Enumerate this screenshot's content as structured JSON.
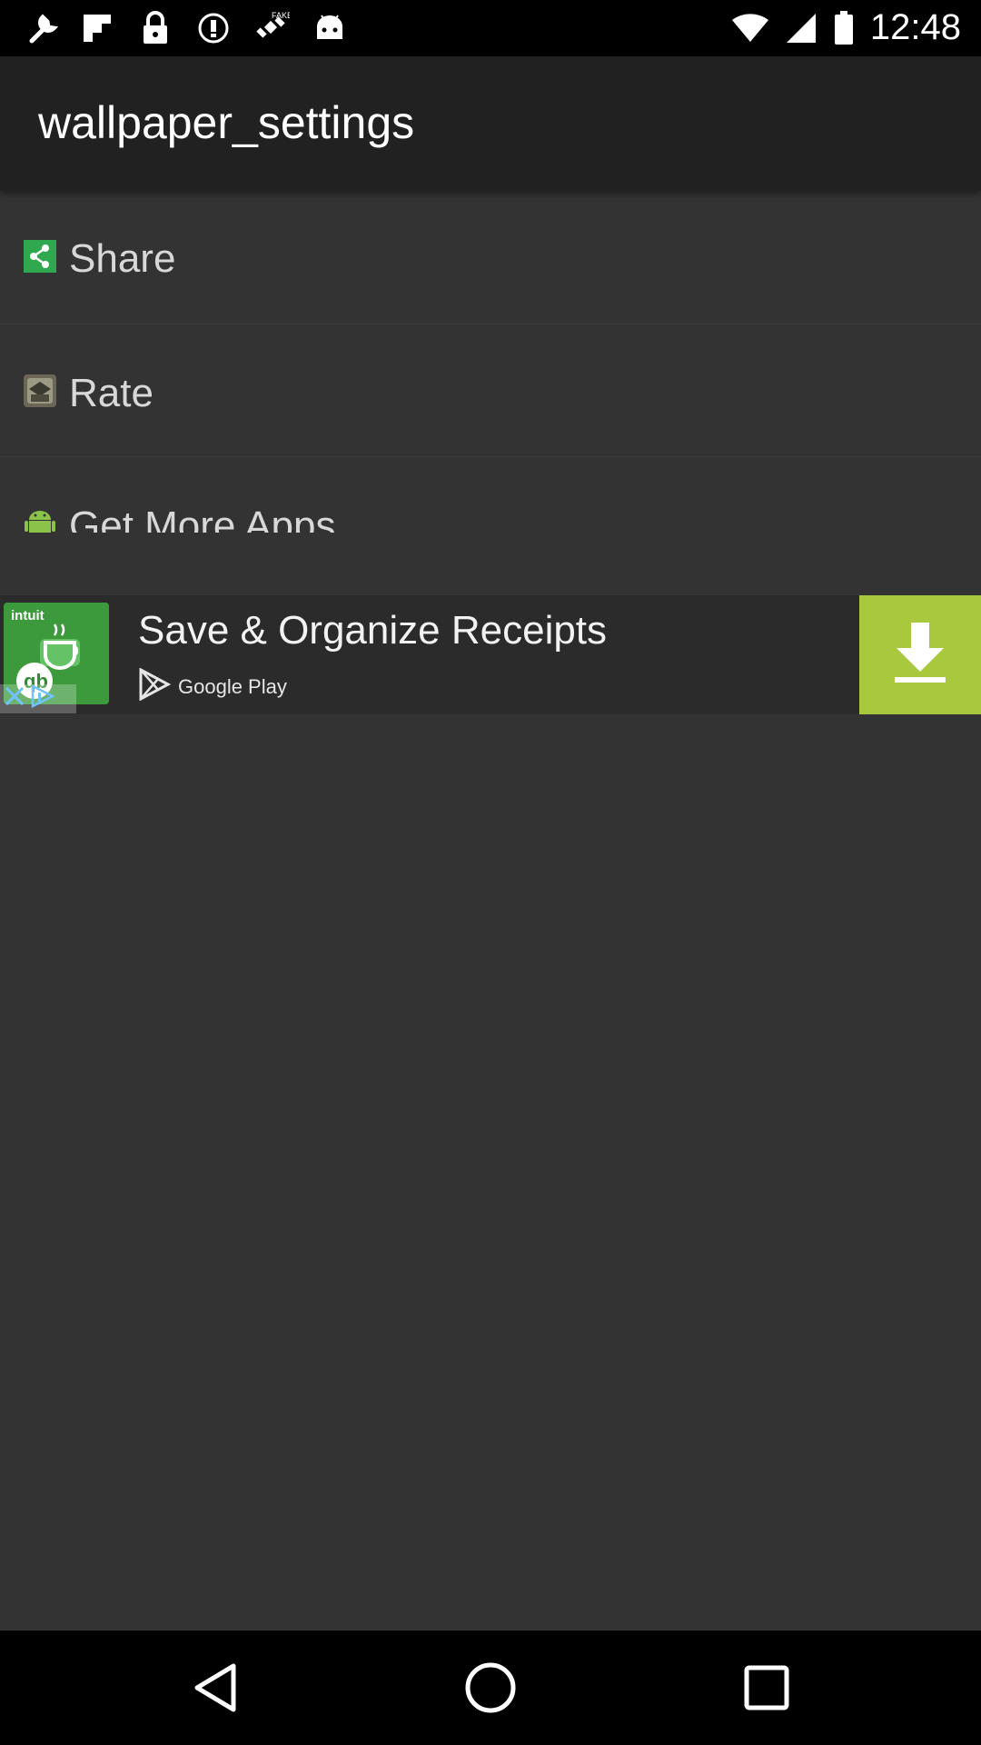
{
  "status_bar": {
    "time": "12:48",
    "icons": [
      "wrench-icon",
      "flipboard-icon",
      "lock-icon",
      "info-icon",
      "satellite-icon",
      "android-icon",
      "wifi-icon",
      "signal-icon",
      "battery-icon"
    ],
    "fake_label": "FAKE"
  },
  "app_bar": {
    "title": "wallpaper_settings"
  },
  "menu": {
    "items": [
      {
        "label": "Share",
        "icon": "share-icon"
      },
      {
        "label": "Rate",
        "icon": "rate-icon"
      },
      {
        "label": "Get More Apps",
        "icon": "android-icon"
      }
    ]
  },
  "ad": {
    "brand": "intuit",
    "headline": "Save & Organize Receipts",
    "store_label": "Google Play",
    "download_icon": "download-icon",
    "accent_color": "#a8c83e"
  },
  "nav_bar": {
    "buttons": [
      "back-icon",
      "home-icon",
      "recents-icon"
    ]
  },
  "colors": {
    "background": "#333333",
    "app_bar": "#212121",
    "share_green": "#2fa84f",
    "android_green": "#8bc34a"
  }
}
